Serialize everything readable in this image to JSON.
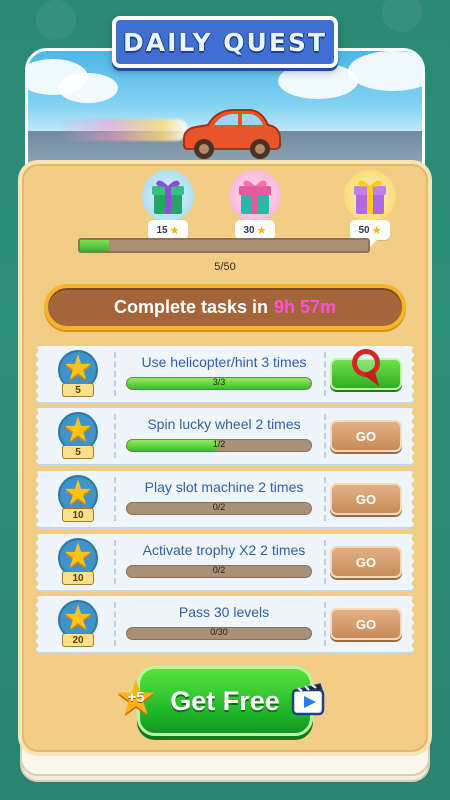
{
  "title": "DAILY QUEST",
  "rewards": [
    {
      "points": "15",
      "color": "#2aa36b"
    },
    {
      "points": "30",
      "color": "#e35c9b"
    },
    {
      "points": "50",
      "color": "#f0b21e"
    }
  ],
  "progress": {
    "text": "5/50",
    "value": 5,
    "max": 50
  },
  "timer": {
    "label": "Complete tasks in",
    "remaining": "9h 57m"
  },
  "tasks": [
    {
      "reward": "5",
      "label": "Use helicopter/hint 3 times",
      "progress_text": "3/3",
      "done": 3,
      "total": 3,
      "button": "claim"
    },
    {
      "reward": "5",
      "label": "Spin lucky wheel 2 times",
      "progress_text": "1/2",
      "done": 1,
      "total": 2,
      "button": "GO"
    },
    {
      "reward": "10",
      "label": "Play slot machine 2 times",
      "progress_text": "0/2",
      "done": 0,
      "total": 2,
      "button": "GO"
    },
    {
      "reward": "10",
      "label": "Activate trophy X2 2 times",
      "progress_text": "0/2",
      "done": 0,
      "total": 2,
      "button": "GO"
    },
    {
      "reward": "20",
      "label": "Pass 30 levels",
      "progress_text": "0/30",
      "done": 0,
      "total": 30,
      "button": "GO"
    }
  ],
  "get_free": {
    "label": "Get Free",
    "bonus": "+5"
  },
  "colors": {
    "accent_green": "#3fb52b",
    "timer_highlight": "#ff4fd6",
    "title_blue": "#3f6fd0"
  }
}
